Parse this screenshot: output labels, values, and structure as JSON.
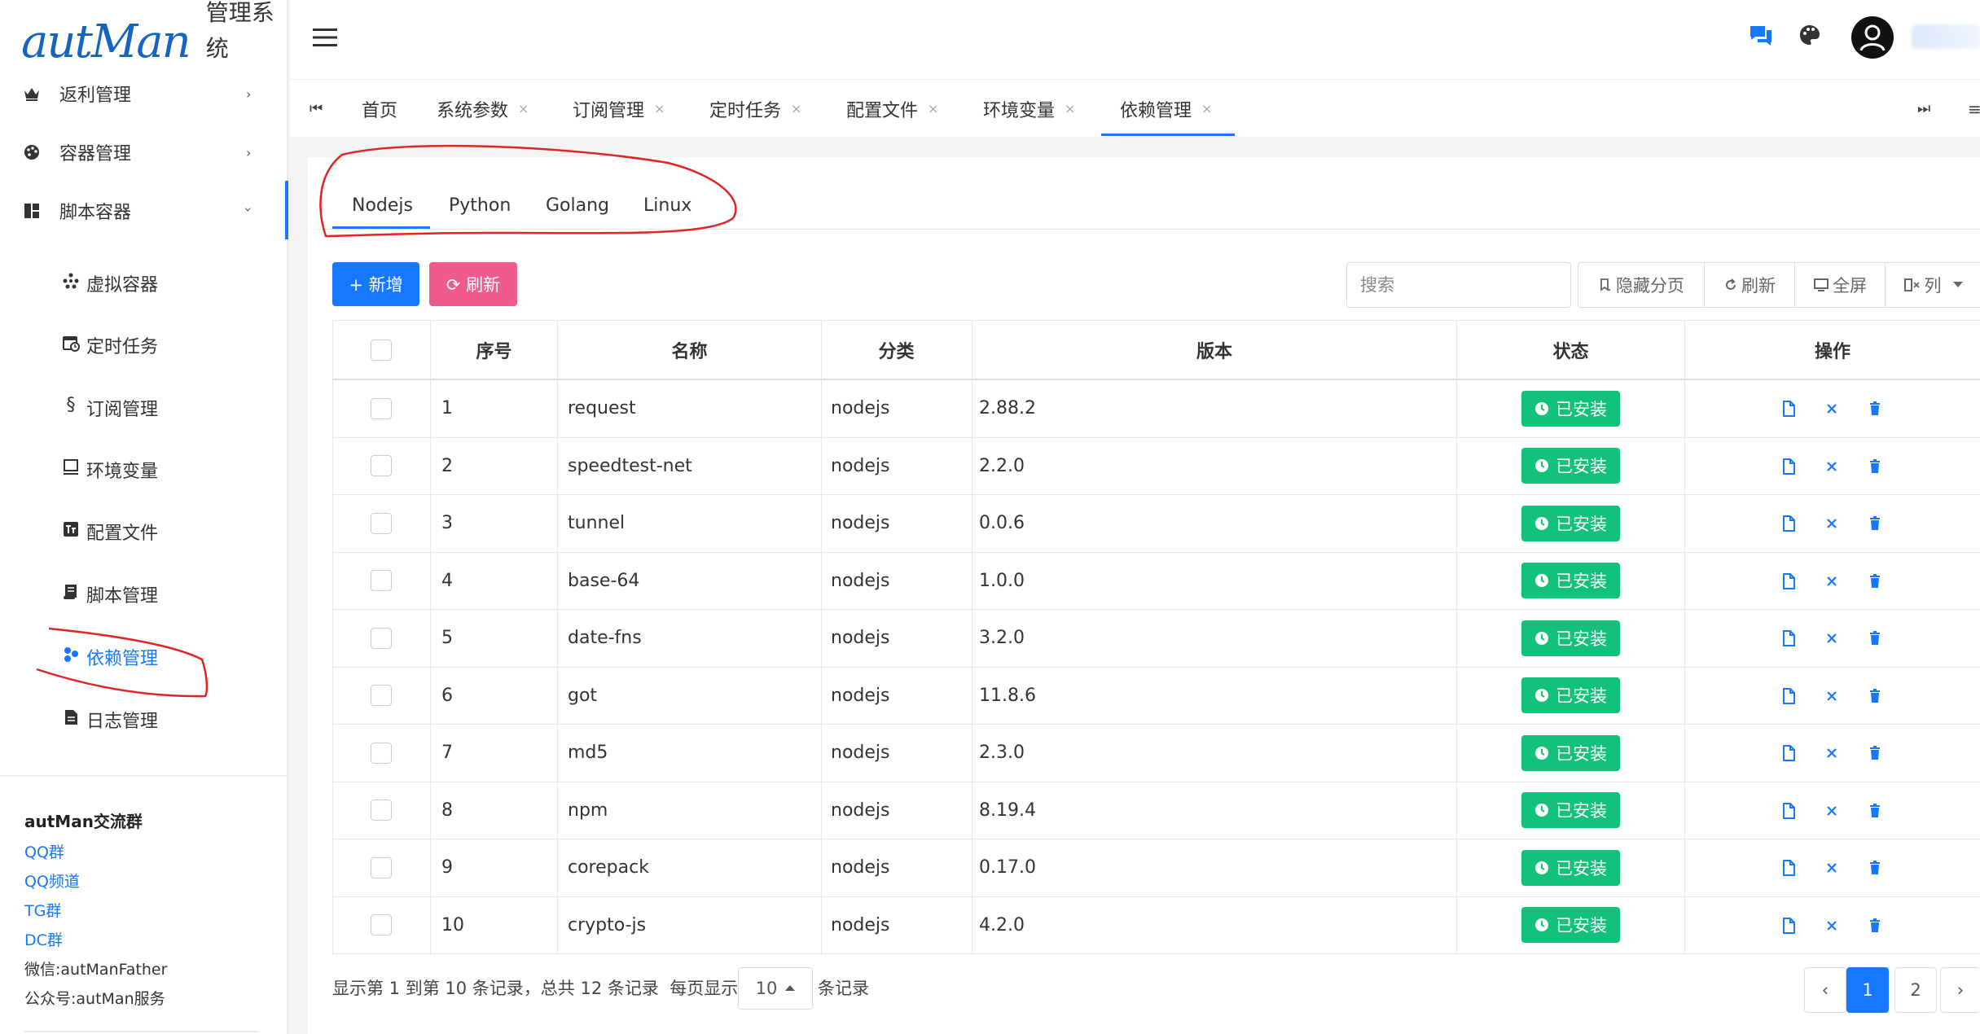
{
  "logo": {
    "script": "autMan",
    "text": "管理系统"
  },
  "sidebar": {
    "menus": [
      {
        "label": "返利管理",
        "icon": "crown-icon",
        "arrow": "›"
      },
      {
        "label": "容器管理",
        "icon": "palette-icon",
        "arrow": "›"
      },
      {
        "label": "脚本容器",
        "icon": "dashboard-icon",
        "arrow": "›"
      }
    ],
    "sub": [
      {
        "label": "虚拟容器",
        "icon": "cluster-icon"
      },
      {
        "label": "定时任务",
        "icon": "calendar-clock-icon"
      },
      {
        "label": "订阅管理",
        "icon": "section-icon"
      },
      {
        "label": "环境变量",
        "icon": "monitor-icon"
      },
      {
        "label": "配置文件",
        "icon": "config-icon"
      },
      {
        "label": "脚本管理",
        "icon": "scroll-icon"
      },
      {
        "label": "依赖管理",
        "icon": "dependency-icon"
      },
      {
        "label": "日志管理",
        "icon": "file-text-icon"
      }
    ],
    "community": {
      "title": "autMan交流群",
      "links": [
        "QQ群",
        "QQ频道",
        "TG群",
        "DC群"
      ],
      "wechat": "微信:autManFather",
      "official": "公众号:autMan服务"
    }
  },
  "tabs": {
    "first": "⏮",
    "last": "⏭",
    "menu": "≡",
    "close": "×",
    "items": [
      "首页",
      "系统参数",
      "订阅管理",
      "定时任务",
      "配置文件",
      "环境变量",
      "依赖管理"
    ]
  },
  "dep_tabs": [
    "Nodejs",
    "Python",
    "Golang",
    "Linux"
  ],
  "toolbar": {
    "add": "+ 新增",
    "refresh": "⟳ 刷新",
    "search_placeholder": "搜索",
    "hide_page": "隐藏分页",
    "tool_refresh": "刷新",
    "fullscreen": "全屏",
    "columns": "列"
  },
  "table": {
    "headers": [
      "序号",
      "名称",
      "分类",
      "版本",
      "状态",
      "操作"
    ],
    "rows": [
      {
        "no": "1",
        "name": "request",
        "cat": "nodejs",
        "ver": "2.88.2",
        "status": "已安装"
      },
      {
        "no": "2",
        "name": "speedtest-net",
        "cat": "nodejs",
        "ver": "2.2.0",
        "status": "已安装"
      },
      {
        "no": "3",
        "name": "tunnel",
        "cat": "nodejs",
        "ver": "0.0.6",
        "status": "已安装"
      },
      {
        "no": "4",
        "name": "base-64",
        "cat": "nodejs",
        "ver": "1.0.0",
        "status": "已安装"
      },
      {
        "no": "5",
        "name": "date-fns",
        "cat": "nodejs",
        "ver": "3.2.0",
        "status": "已安装"
      },
      {
        "no": "6",
        "name": "got",
        "cat": "nodejs",
        "ver": "11.8.6",
        "status": "已安装"
      },
      {
        "no": "7",
        "name": "md5",
        "cat": "nodejs",
        "ver": "2.3.0",
        "status": "已安装"
      },
      {
        "no": "8",
        "name": "npm",
        "cat": "nodejs",
        "ver": "8.19.4",
        "status": "已安装"
      },
      {
        "no": "9",
        "name": "corepack",
        "cat": "nodejs",
        "ver": "0.17.0",
        "status": "已安装"
      },
      {
        "no": "10",
        "name": "crypto-js",
        "cat": "nodejs",
        "ver": "4.2.0",
        "status": "已安装"
      }
    ]
  },
  "pagination": {
    "info": "显示第 1 到第 10 条记录，总共 12 条记录",
    "per_page_label": "每页显示",
    "page_size": "10",
    "unit": "条记录",
    "prev": "‹",
    "next": "›",
    "pages": [
      "1",
      "2"
    ]
  },
  "colors": {
    "primary": "#1677ff",
    "pink": "#f05b8e",
    "green": "#13c27a",
    "annotation": "#e02424"
  }
}
